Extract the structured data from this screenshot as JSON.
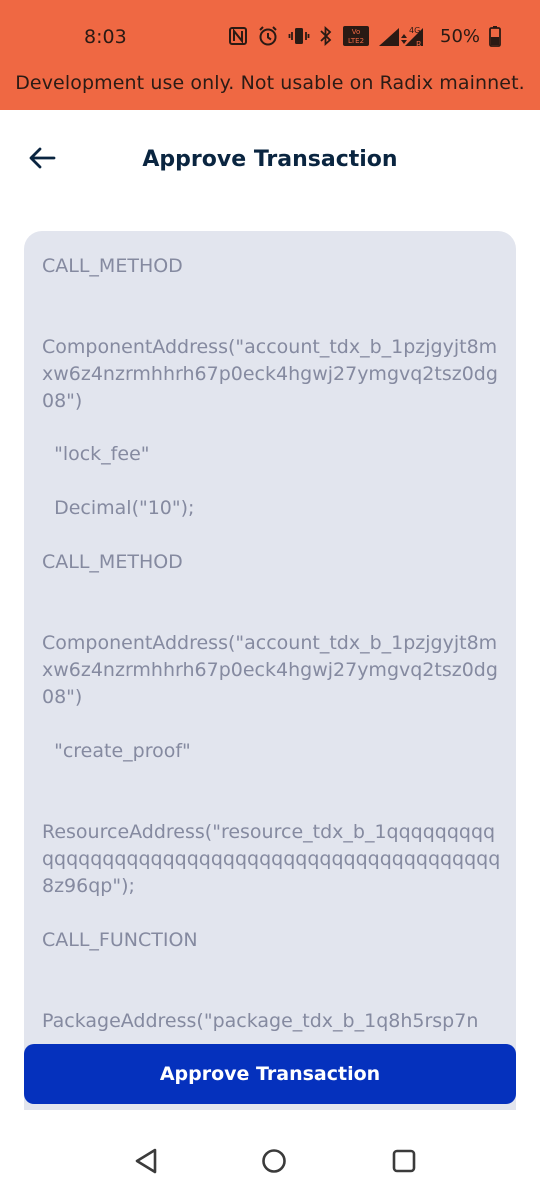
{
  "status_bar": {
    "time": "8:03",
    "battery": "50%",
    "icons": [
      "nfc-icon",
      "alarm-icon",
      "vibrate-icon",
      "bluetooth-icon",
      "volte-icon",
      "signal-icon",
      "battery-icon"
    ],
    "background": "#ef6843"
  },
  "banner": {
    "text": "Development use only. Not usable on Radix mainnet."
  },
  "header": {
    "back_icon": "arrow-left-icon",
    "title": "Approve Transaction"
  },
  "manifest": {
    "lines": [
      "CALL_METHOD",
      "ComponentAddress(\"account_tdx_b_1pzjgyjt8mxw6z4nzrmhhrh67p0eck4hgwj27ymgvq2tsz0dg08\")",
      "  \"lock_fee\"",
      "  Decimal(\"10\");",
      "CALL_METHOD",
      "ComponentAddress(\"account_tdx_b_1pzjgyjt8mxw6z4nzrmhhrh67p0eck4hgwj27ymgvq2tsz0dg08\")",
      "  \"create_proof\"",
      "ResourceAddress(\"resource_tdx_b_1qqqqqqqqqqqqqqqqqqqqqqqqqqqqqqqqqqqqqqqqqqqqqqq8z96qp\");",
      "CALL_FUNCTION",
      "PackageAddress(\"package_tdx_b_1q8h5rsp7n"
    ],
    "background": "#e2e5ee"
  },
  "approve_button": {
    "label": "Approve Transaction",
    "color": "#0531bd"
  },
  "nav_bar": {
    "icons": [
      "back-triangle-icon",
      "home-circle-icon",
      "recents-square-icon"
    ]
  }
}
